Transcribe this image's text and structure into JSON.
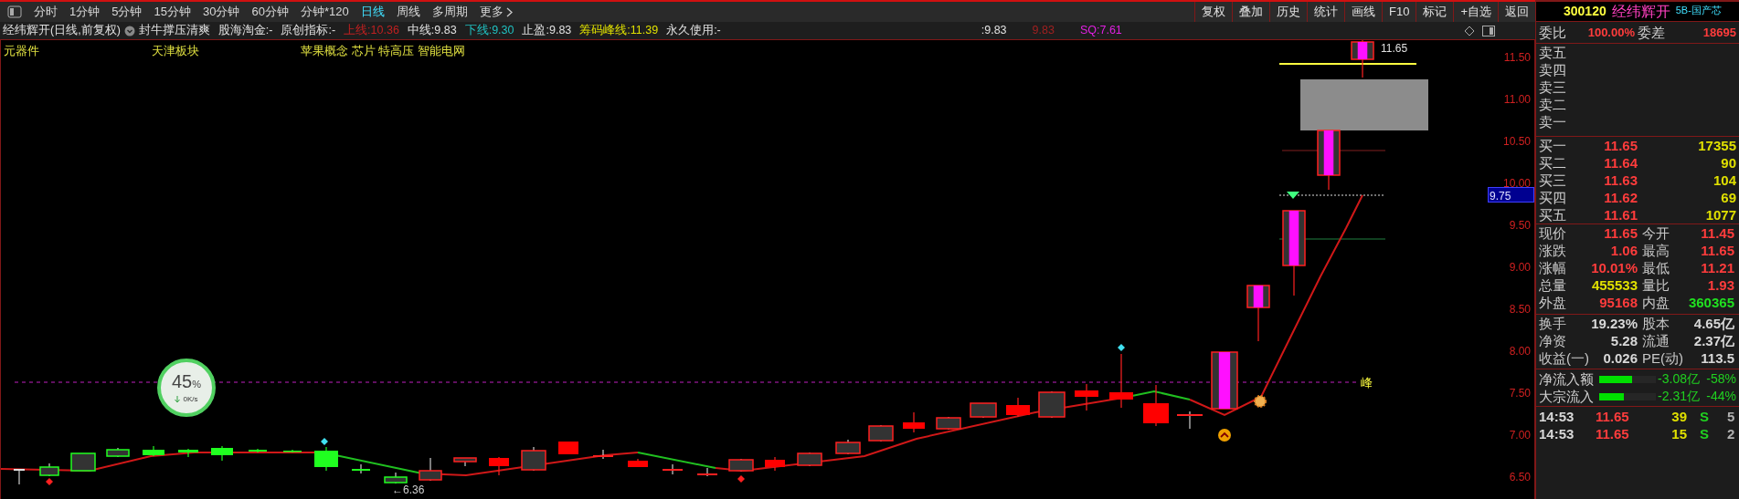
{
  "toolbar": {
    "period_tabs": [
      {
        "label": "分时",
        "selected": false
      },
      {
        "label": "1分钟",
        "selected": false
      },
      {
        "label": "5分钟",
        "selected": false
      },
      {
        "label": "15分钟",
        "selected": false
      },
      {
        "label": "30分钟",
        "selected": false
      },
      {
        "label": "60分钟",
        "selected": false
      },
      {
        "label": "分钟*120",
        "selected": false
      },
      {
        "label": "日线",
        "selected": true
      },
      {
        "label": "周线",
        "selected": false
      },
      {
        "label": "多周期",
        "selected": false
      }
    ],
    "more": "更多",
    "buttons": [
      "复权",
      "叠加",
      "历史",
      "统计",
      "画线",
      "F10",
      "标记",
      "+自选",
      "返回"
    ]
  },
  "info_bar": {
    "title": "经纬辉开(日线,前复权)",
    "indicator": "封牛撑压清爽",
    "items": [
      {
        "text": "股海淘金:-",
        "color": "#e0e0e0"
      },
      {
        "text": "原创指标:-",
        "color": "#e0e0e0"
      },
      {
        "text": "上线:10.36",
        "color": "#c02020"
      },
      {
        "text": "中线:9.83",
        "color": "#e0e0e0"
      },
      {
        "text": "下线:9.30",
        "color": "#20c0c0"
      },
      {
        "text": "止盈:9.83",
        "color": "#e0e0e0"
      },
      {
        "text": "筹码峰线:11.39",
        "color": "#e0e000"
      },
      {
        "text": "永久使用:-",
        "color": "#e0e0e0"
      }
    ],
    "extra": [
      {
        "text": ":9.83",
        "color": "#e0e0e0"
      },
      {
        "text": "9.83",
        "color": "#a02020"
      },
      {
        "text": "SQ:7.61",
        "color": "#e020e0"
      }
    ]
  },
  "chart": {
    "concepts": [
      "元器件",
      "天津板块",
      "苹果概念 芯片 特高压 智能电网"
    ],
    "price_axis": [
      "11.50",
      "11.00",
      "10.50",
      "10.00",
      "9.50",
      "9.00",
      "8.50",
      "8.00",
      "7.50",
      "7.00",
      "6.50"
    ],
    "current_price_label": "9.75",
    "high_label": "11.65",
    "low_label": "←6.36",
    "peak_label": "峰",
    "speed_widget": {
      "percent": "45",
      "unit": "%",
      "speed": "0K/s"
    }
  },
  "quote": {
    "code": "300120",
    "name": "经纬辉开",
    "sector": "5B-国产芯",
    "ratio": {
      "label": "委比",
      "value": "100.00%"
    },
    "diff": {
      "label": "委差",
      "value": "18695"
    },
    "asks": [
      "卖五",
      "卖四",
      "卖三",
      "卖二",
      "卖一"
    ],
    "bids": [
      {
        "label": "买一",
        "price": "11.65",
        "volume": "17355"
      },
      {
        "label": "买二",
        "price": "11.64",
        "volume": "90"
      },
      {
        "label": "买三",
        "price": "11.63",
        "volume": "104"
      },
      {
        "label": "买四",
        "price": "11.62",
        "volume": "69"
      },
      {
        "label": "买五",
        "price": "11.61",
        "volume": "1077"
      }
    ],
    "stats": [
      {
        "label": "现价",
        "value": "11.65",
        "color": "#ff3c3c"
      },
      {
        "label": "今开",
        "value": "11.45",
        "color": "#ff3c3c"
      },
      {
        "label": "涨跌",
        "value": "1.06",
        "color": "#ff3c3c"
      },
      {
        "label": "最高",
        "value": "11.65",
        "color": "#ff3c3c"
      },
      {
        "label": "涨幅",
        "value": "10.01%",
        "color": "#ff3c3c"
      },
      {
        "label": "最低",
        "value": "11.21",
        "color": "#ff3c3c"
      },
      {
        "label": "总量",
        "value": "455533",
        "color": "#e0e000"
      },
      {
        "label": "量比",
        "value": "1.93",
        "color": "#ff3c3c"
      },
      {
        "label": "外盘",
        "value": "95168",
        "color": "#ff3c3c"
      },
      {
        "label": "内盘",
        "value": "360365",
        "color": "#20e020"
      }
    ],
    "finance": [
      {
        "label": "换手",
        "value": "19.23%"
      },
      {
        "label": "股本",
        "value": "4.65亿"
      },
      {
        "label": "净资",
        "value": "5.28"
      },
      {
        "label": "流通",
        "value": "2.37亿"
      },
      {
        "label": "收益(一)",
        "value": "0.026"
      },
      {
        "label": "PE(动)",
        "value": "113.5"
      }
    ],
    "fund_flow": [
      {
        "label": "净流入额",
        "level": 0.58,
        "amount": "-3.08亿",
        "percent": "-58%"
      },
      {
        "label": "大宗流入",
        "level": 0.44,
        "amount": "-2.31亿",
        "percent": "-44%"
      }
    ],
    "trades": [
      {
        "time": "14:53",
        "price": "11.65",
        "volume": "39",
        "side": "S",
        "count": "5"
      },
      {
        "time": "14:53",
        "price": "11.65",
        "volume": "15",
        "side": "S",
        "count": "2"
      }
    ]
  }
}
